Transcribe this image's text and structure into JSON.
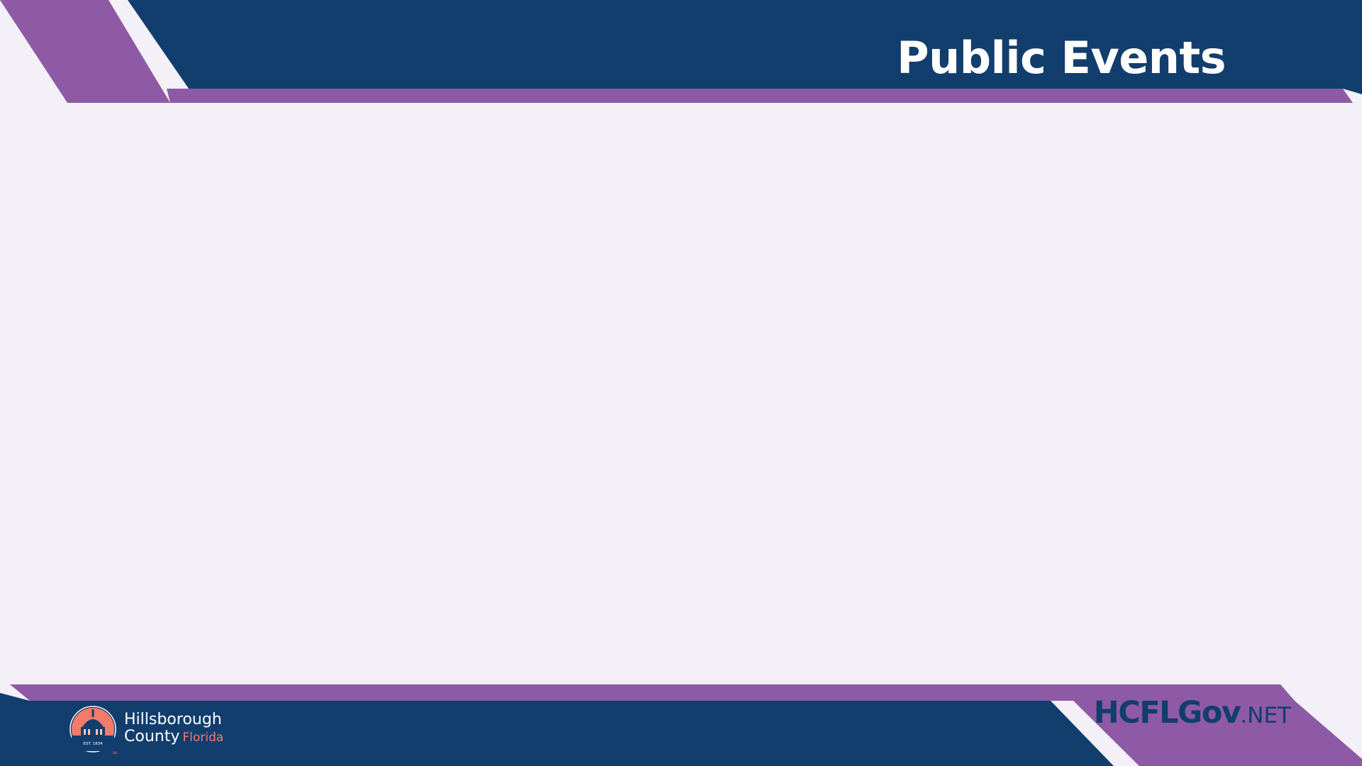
{
  "slide": {
    "title": "Public Events"
  },
  "logo": {
    "line1": "Hillsborough",
    "line2": "County",
    "state": "Florida",
    "est": "EST. 1834",
    "mark": "SM",
    "icon": "courthouse-dome-seal-icon"
  },
  "website": {
    "part1": "HCFLGov",
    "part2": ".NET"
  },
  "colors": {
    "navy": "#123e6d",
    "purple": "#8e5aa5",
    "background": "#f4f0f7",
    "coral": "#f47b6b"
  }
}
